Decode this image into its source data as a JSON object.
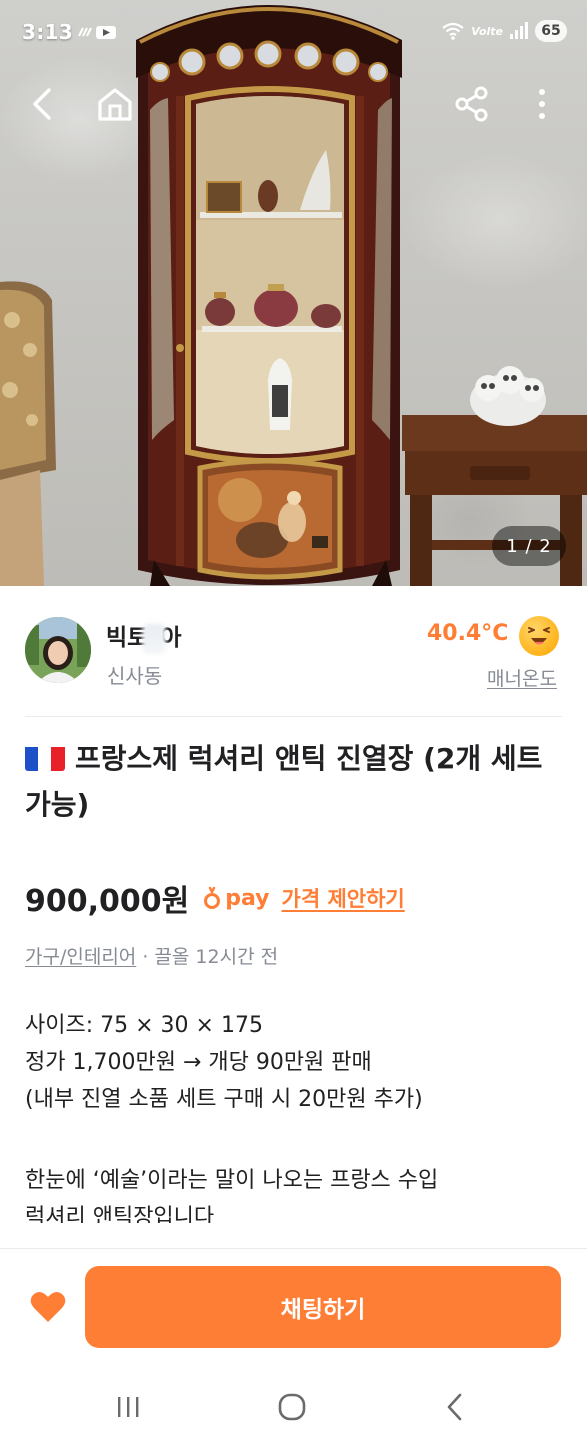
{
  "status_bar": {
    "time": "3:13",
    "carrier_tag": "Volte",
    "battery": "65"
  },
  "gallery": {
    "counter": "1 / 2"
  },
  "seller": {
    "name_start": "빅토",
    "name_end": "아",
    "location": "신사동",
    "manner_temperature": "40.4°C",
    "manner_label": "매너온도"
  },
  "listing": {
    "title": "프랑스제 럭셔리 앤틱 진열장 (2개 세트 가능)",
    "price": "900,000원",
    "pay_label": "pay",
    "price_offer_label": "가격 제안하기",
    "category": "가구/인테리어",
    "meta_separator": " · ",
    "bump_time": "끌올 12시간 전",
    "description_lines": [
      "사이즈: 75 × 30 × 175",
      "정가 1,700만원 → 개당 90만원 판매",
      "(내부 진열 소품 세트 구매 시 20만원 추가)",
      "한눈에 ‘예술’이라는 말이 나오는 프랑스 수입",
      "럭셔리 앤틱장입니다"
    ]
  },
  "actions": {
    "chat_label": "채팅하기"
  },
  "colors": {
    "accent": "#ff7e36",
    "muted_text": "#868b94",
    "primary_text": "#212124"
  },
  "icons": {
    "back": "back-arrow-icon",
    "home": "home-icon",
    "share": "share-icon",
    "more": "more-vertical-icon",
    "like": "heart-icon",
    "temperature": "smiley-face-icon"
  }
}
